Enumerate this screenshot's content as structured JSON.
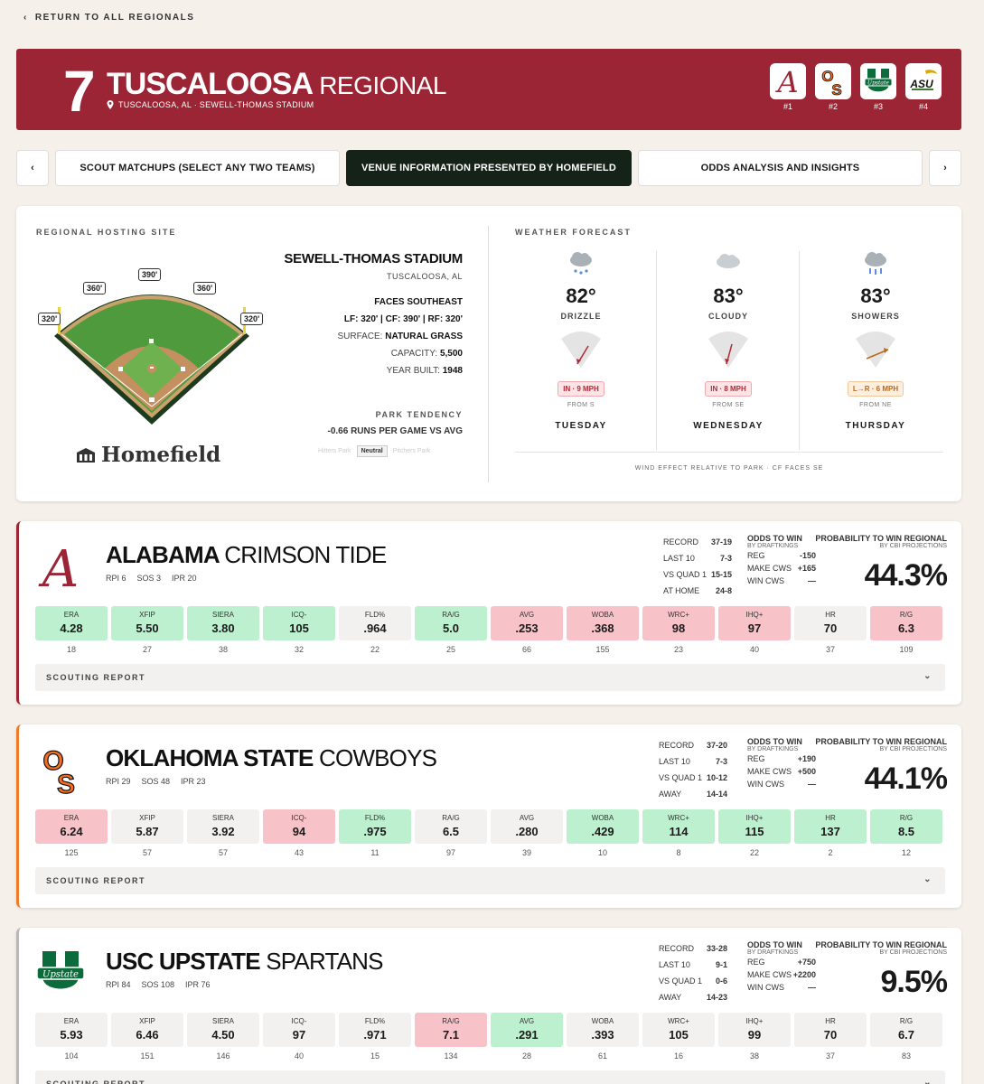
{
  "nav": {
    "back_label": "RETURN TO ALL REGIONALS"
  },
  "banner": {
    "seed": "7",
    "title_bold": "TUSCALOOSA",
    "title_light": "REGIONAL",
    "location": "TUSCALOOSA, AL · SEWELL-THOMAS STADIUM",
    "teams": [
      {
        "seed_label": "#1",
        "logo": "alabama-logo"
      },
      {
        "seed_label": "#2",
        "logo": "oklahoma-state-logo"
      },
      {
        "seed_label": "#3",
        "logo": "usc-upstate-logo"
      },
      {
        "seed_label": "#4",
        "logo": "asu-logo"
      }
    ]
  },
  "tabs": [
    {
      "label": "SCOUT MATCHUPS (SELECT ANY TWO TEAMS)",
      "active": false
    },
    {
      "label": "VENUE INFORMATION PRESENTED BY HOMEFIELD",
      "active": true
    },
    {
      "label": "ODDS ANALYSIS AND INSIGHTS",
      "active": false
    }
  ],
  "venue": {
    "section_label": "REGIONAL HOSTING SITE",
    "fences": {
      "lf_line": "320'",
      "lf": "360'",
      "cf": "390'",
      "rf": "360'",
      "rf_line": "320'"
    },
    "sponsor": "Homefield",
    "name": "SEWELL-THOMAS STADIUM",
    "city": "TUSCALOOSA, AL",
    "faces": "FACES SOUTHEAST",
    "dims": "LF: 320' | CF: 390' | RF: 320'",
    "surface_label": "SURFACE:",
    "surface": "NATURAL GRASS",
    "capacity_label": "CAPACITY:",
    "capacity": "5,500",
    "year_label": "YEAR BUILT:",
    "year": "1948",
    "tendency_label": "PARK TENDENCY",
    "tendency_value": "-0.66 RUNS PER GAME VS AVG",
    "tendency_options": [
      "Hitters Park",
      "Neutral",
      "Pitchers Park"
    ]
  },
  "weather": {
    "section_label": "WEATHER FORECAST",
    "footer": "WIND EFFECT RELATIVE TO PARK · CF FACES SE",
    "days": [
      {
        "temp": "82°",
        "condition": "DRIZZLE",
        "wind": "IN · 9 MPH",
        "from": "FROM S",
        "day": "TUESDAY"
      },
      {
        "temp": "83°",
        "condition": "CLOUDY",
        "wind": "IN · 8 MPH",
        "from": "FROM SE",
        "day": "WEDNESDAY"
      },
      {
        "temp": "83°",
        "condition": "SHOWERS",
        "wind": "L→R · 6 MPH",
        "from": "FROM NE",
        "day": "THURSDAY"
      }
    ]
  },
  "labels": {
    "odds_head": "ODDS TO WIN",
    "odds_sub": "BY DRAFTKINGS",
    "prob_head": "PROBABILITY TO WIN REGIONAL",
    "prob_sub": "BY CBI PROJECTIONS",
    "scout": "SCOUTING REPORT",
    "reg": "REG",
    "make_cws": "MAKE CWS",
    "win_cws": "WIN CWS",
    "record": "RECORD",
    "last10": "LAST 10",
    "vsq1": "VS QUAD 1"
  },
  "teams": [
    {
      "name_bold": "ALABAMA",
      "name_light": "CRIMSON TIDE",
      "rpi": "RPI 6",
      "sos": "SOS 3",
      "ipr": "IPR 20",
      "record": "37-19",
      "last10": "7-3",
      "vsq1": "15-15",
      "loc_label": "AT HOME",
      "loc": "24-8",
      "odds_reg": "-150",
      "odds_make": "+165",
      "odds_win": "—",
      "prob": "44.3%",
      "stats": [
        {
          "k": "ERA",
          "v": "4.28",
          "r": "18",
          "c": "g"
        },
        {
          "k": "XFIP",
          "v": "5.50",
          "r": "27",
          "c": "g"
        },
        {
          "k": "SIERA",
          "v": "3.80",
          "r": "38",
          "c": "g"
        },
        {
          "k": "ICQ-",
          "v": "105",
          "r": "32",
          "c": "g"
        },
        {
          "k": "FLD%",
          "v": ".964",
          "r": "22",
          "c": "n"
        },
        {
          "k": "RA/G",
          "v": "5.0",
          "r": "25",
          "c": "g"
        },
        {
          "k": "AVG",
          "v": ".253",
          "r": "66",
          "c": "r"
        },
        {
          "k": "WOBA",
          "v": ".368",
          "r": "155",
          "c": "r"
        },
        {
          "k": "WRC+",
          "v": "98",
          "r": "23",
          "c": "r"
        },
        {
          "k": "IHQ+",
          "v": "97",
          "r": "40",
          "c": "r"
        },
        {
          "k": "HR",
          "v": "70",
          "r": "37",
          "c": "n"
        },
        {
          "k": "R/G",
          "v": "6.3",
          "r": "109",
          "c": "r"
        }
      ]
    },
    {
      "name_bold": "OKLAHOMA STATE",
      "name_light": "COWBOYS",
      "rpi": "RPI 29",
      "sos": "SOS 48",
      "ipr": "IPR 23",
      "record": "37-20",
      "last10": "7-3",
      "vsq1": "10-12",
      "loc_label": "AWAY",
      "loc": "14-14",
      "odds_reg": "+190",
      "odds_make": "+500",
      "odds_win": "—",
      "prob": "44.1%",
      "stats": [
        {
          "k": "ERA",
          "v": "6.24",
          "r": "125",
          "c": "r"
        },
        {
          "k": "XFIP",
          "v": "5.87",
          "r": "57",
          "c": "n"
        },
        {
          "k": "SIERA",
          "v": "3.92",
          "r": "57",
          "c": "n"
        },
        {
          "k": "ICQ-",
          "v": "94",
          "r": "43",
          "c": "r"
        },
        {
          "k": "FLD%",
          "v": ".975",
          "r": "11",
          "c": "g"
        },
        {
          "k": "RA/G",
          "v": "6.5",
          "r": "97",
          "c": "n"
        },
        {
          "k": "AVG",
          "v": ".280",
          "r": "39",
          "c": "n"
        },
        {
          "k": "WOBA",
          "v": ".429",
          "r": "10",
          "c": "g"
        },
        {
          "k": "WRC+",
          "v": "114",
          "r": "8",
          "c": "g"
        },
        {
          "k": "IHQ+",
          "v": "115",
          "r": "22",
          "c": "g"
        },
        {
          "k": "HR",
          "v": "137",
          "r": "2",
          "c": "g"
        },
        {
          "k": "R/G",
          "v": "8.5",
          "r": "12",
          "c": "g"
        }
      ]
    },
    {
      "name_bold": "USC UPSTATE",
      "name_light": "SPARTANS",
      "rpi": "RPI 84",
      "sos": "SOS 108",
      "ipr": "IPR 76",
      "record": "33-28",
      "last10": "9-1",
      "vsq1": "0-6",
      "loc_label": "AWAY",
      "loc": "14-23",
      "odds_reg": "+750",
      "odds_make": "+2200",
      "odds_win": "—",
      "prob": "9.5%",
      "stats": [
        {
          "k": "ERA",
          "v": "5.93",
          "r": "104",
          "c": "n"
        },
        {
          "k": "XFIP",
          "v": "6.46",
          "r": "151",
          "c": "n"
        },
        {
          "k": "SIERA",
          "v": "4.50",
          "r": "146",
          "c": "n"
        },
        {
          "k": "ICQ-",
          "v": "97",
          "r": "40",
          "c": "n"
        },
        {
          "k": "FLD%",
          "v": ".971",
          "r": "15",
          "c": "n"
        },
        {
          "k": "RA/G",
          "v": "7.1",
          "r": "134",
          "c": "r"
        },
        {
          "k": "AVG",
          "v": ".291",
          "r": "28",
          "c": "g"
        },
        {
          "k": "WOBA",
          "v": ".393",
          "r": "61",
          "c": "n"
        },
        {
          "k": "WRC+",
          "v": "105",
          "r": "16",
          "c": "n"
        },
        {
          "k": "IHQ+",
          "v": "99",
          "r": "38",
          "c": "n"
        },
        {
          "k": "HR",
          "v": "70",
          "r": "37",
          "c": "n"
        },
        {
          "k": "R/G",
          "v": "6.7",
          "r": "83",
          "c": "n"
        }
      ]
    }
  ]
}
